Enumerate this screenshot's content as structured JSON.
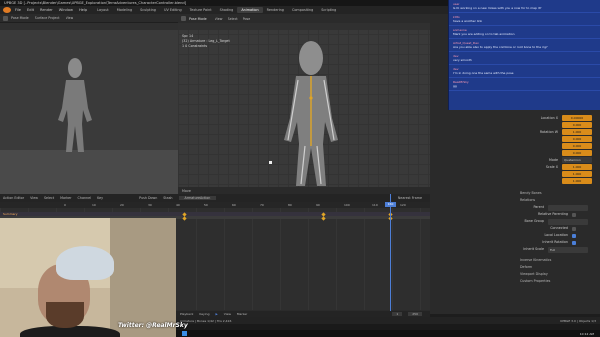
{
  "title": "UPBGE 3D [..Projects\\Blender\\Games\\UPBGE_Exploration\\TerraAdventures_CharacterController.blend]",
  "menu": [
    "File",
    "Edit",
    "Render",
    "Window",
    "Help"
  ],
  "workspaces": [
    "Layout",
    "Modeling",
    "Sculpting",
    "UV Editing",
    "Texture Paint",
    "Shading",
    "Animation",
    "Rendering",
    "Compositing",
    "Scripting"
  ],
  "active_workspace": "Animation",
  "viewport_left": {
    "mode": "Pose Mode",
    "orientation": "Surface Project",
    "view": "View"
  },
  "viewport_center": {
    "mode": "Pose Mode",
    "menus": [
      "View",
      "Select",
      "Pose"
    ],
    "info": [
      "Spc 14",
      "(32) Armature : Leg_L_Target",
      "1 0 Constraints"
    ],
    "footer": "Move"
  },
  "chat": [
    {
      "user": "user",
      "body": "Is IK working on a new mixes with you a now for to map it?"
    },
    {
      "user": "kitto",
      "body": "have a another link"
    },
    {
      "user": "someone",
      "body": "Mark you are adding on to tab animation"
    },
    {
      "user": "Artist_Quest_Dev",
      "body": "Are you able also to apply the combine or root bone to the rig?"
    },
    {
      "user": "dev",
      "body": "very smooth"
    },
    {
      "user": "dev",
      "body": "I'm in doing one the same with the pose"
    },
    {
      "user": "RealMrSky",
      "body": "gg"
    }
  ],
  "properties": {
    "location_label": "Location X",
    "rotation_label": "Rotation W",
    "mode_label": "Mode",
    "mode_value": "Quaternion",
    "scale_label": "Scale X",
    "values": [
      "0.00000",
      "0.000",
      "0.000",
      "1.000",
      "0.000",
      "0.000",
      "0.000",
      "1.000",
      "1.000",
      "1.000"
    ],
    "sections": [
      "Bendy Bones",
      "Relations",
      "Inverse Kinematics",
      "Deform",
      "Viewport Display",
      "Custom Properties"
    ],
    "relations": {
      "parent_label": "Parent",
      "relative_parenting": "Relative Parenting",
      "bone_group": "Bone Group",
      "connected": "Connected",
      "local_location": "Local Location",
      "inherit_rotation": "Inherit Rotation",
      "inherit_scale": "Inherit Scale",
      "inherit_scale_value": "Full"
    },
    "bottom_item": "Custom Properties"
  },
  "timeline": {
    "header": [
      "Action Editor",
      "View",
      "Select",
      "Marker",
      "Channel",
      "Key"
    ],
    "action": "ArmatureAction",
    "push_down": "Push Down",
    "stash": "Stash",
    "summary_label": "Summary",
    "nearest_frame": "Nearest Frame",
    "ruler": [
      "0",
      "10",
      "20",
      "30",
      "40",
      "50",
      "60",
      "70",
      "80",
      "90",
      "100",
      "110",
      "120",
      "130",
      "140",
      "150"
    ],
    "current_frame": "160",
    "footer_buttons": [
      "Playback",
      "Keying",
      "View",
      "Marker"
    ],
    "start": "1",
    "end": "250"
  },
  "webcam": {
    "overlay": "Twitter: @RealMrSky"
  },
  "status": {
    "left": "Armature | Bones 1/42 | Tris 2,416",
    "right": "UPBGE 3.0 | Objects 1/3",
    "time": "10:12 AM"
  },
  "colors": {
    "keyframe": "#e0a526",
    "playhead": "#4d7ed6",
    "chat_bg": "#1f3a8a"
  }
}
